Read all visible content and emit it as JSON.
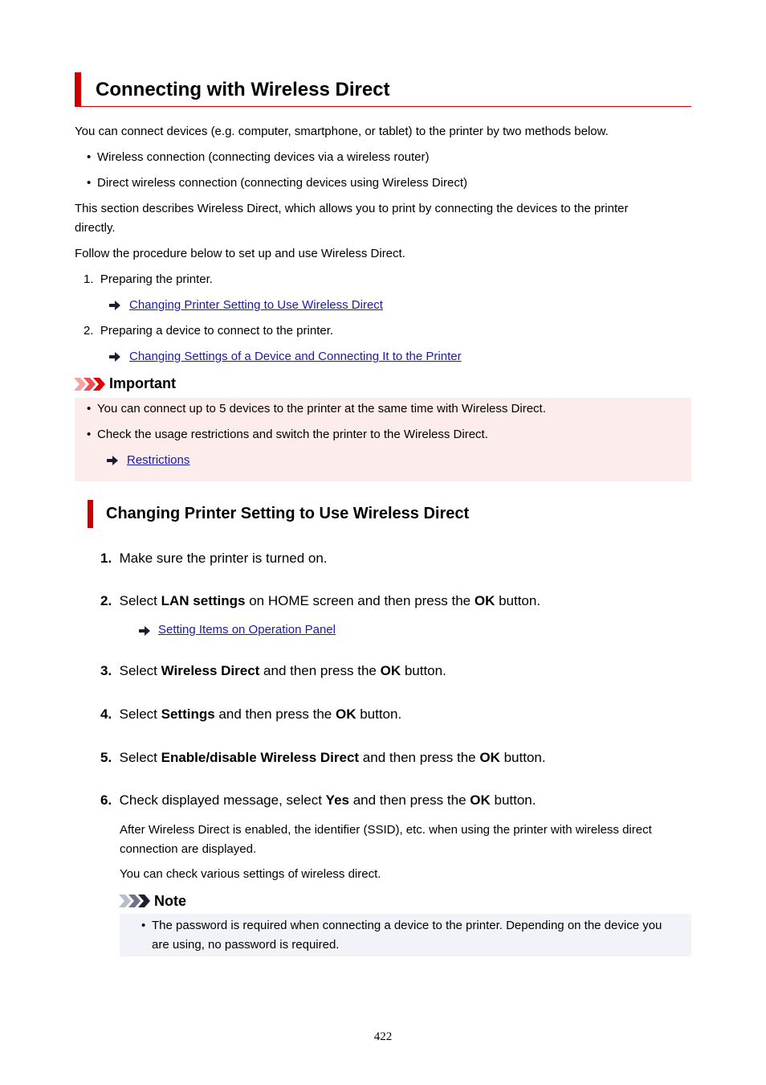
{
  "title": "Connecting with Wireless Direct",
  "intro": "You can connect devices (e.g. computer, smartphone, or tablet) to the printer by two methods below.",
  "methods": [
    "Wireless connection (connecting devices via a wireless router)",
    "Direct wireless connection (connecting devices using Wireless Direct)"
  ],
  "description_line1": "This section describes Wireless Direct, which allows you to print by connecting the devices to the printer",
  "description_line2": "directly.",
  "follow": "Follow the procedure below to set up and use Wireless Direct.",
  "procedure": [
    {
      "num": "1.",
      "text": "Preparing the printer.",
      "link": "Changing Printer Setting to Use Wireless Direct"
    },
    {
      "num": "2.",
      "text": "Preparing a device to connect to the printer.",
      "link": "Changing Settings of a Device and Connecting It to the Printer"
    }
  ],
  "important": {
    "label": "Important",
    "items": [
      "You can connect up to 5 devices to the printer at the same time with Wireless Direct.",
      "Check the usage restrictions and switch the printer to the Wireless Direct."
    ],
    "link": "Restrictions"
  },
  "section2": {
    "title": "Changing Printer Setting to Use Wireless Direct",
    "steps": [
      {
        "num": "1.",
        "parts": [
          "Make sure the printer is turned on."
        ]
      },
      {
        "num": "2.",
        "parts": [
          "Select ",
          "LAN settings",
          " on HOME screen and then press the ",
          "OK",
          " button."
        ],
        "link": "Setting Items on Operation Panel"
      },
      {
        "num": "3.",
        "parts": [
          "Select ",
          "Wireless Direct",
          " and then press the ",
          "OK",
          " button."
        ]
      },
      {
        "num": "4.",
        "parts": [
          "Select ",
          "Settings",
          " and then press the ",
          "OK",
          " button."
        ]
      },
      {
        "num": "5.",
        "parts": [
          "Select ",
          "Enable/disable Wireless Direct",
          " and then press the ",
          "OK",
          " button."
        ]
      },
      {
        "num": "6.",
        "parts": [
          "Check displayed message, select ",
          "Yes",
          " and then press the ",
          "OK",
          " button."
        ]
      }
    ],
    "after_line1": "After Wireless Direct is enabled, the identifier (SSID), etc. when using the printer with wireless direct",
    "after_line2": "connection are displayed.",
    "check": "You can check various settings of wireless direct.",
    "note": {
      "label": "Note",
      "line1": "The password is required when connecting a device to the printer. Depending on the device you",
      "line2": "are using, no password is required."
    }
  },
  "page_number": "422",
  "colors": {
    "accent": "#cc0000",
    "link": "#1a1aa6",
    "important_bg": "#fdecec",
    "note_bg": "#f2f3f8"
  }
}
